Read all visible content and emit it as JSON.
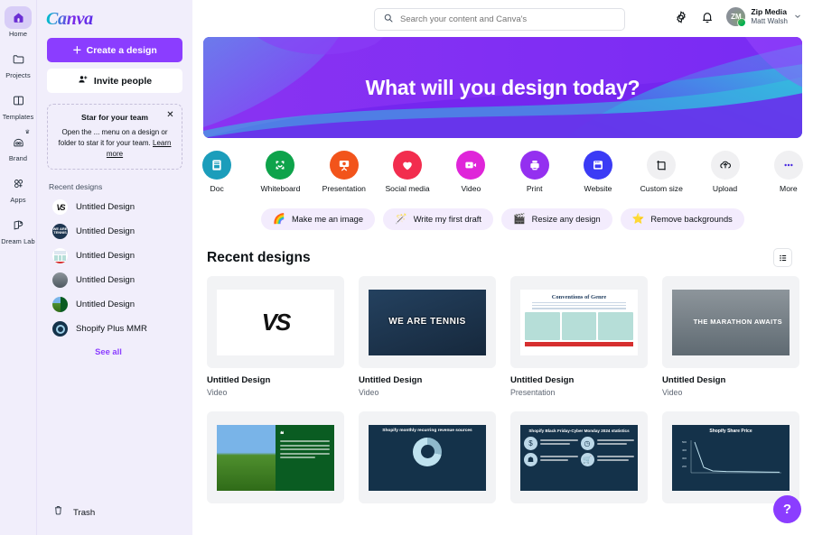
{
  "brand": {
    "logo_text": "Canva",
    "accent": "#8b3dff"
  },
  "rail": {
    "items": [
      {
        "label": "Home",
        "icon": "home-icon",
        "active": true
      },
      {
        "label": "Projects",
        "icon": "folder-icon",
        "active": false
      },
      {
        "label": "Templates",
        "icon": "templates-icon",
        "active": false
      },
      {
        "label": "Brand",
        "icon": "brand-icon",
        "active": false,
        "badge": "crown-icon"
      },
      {
        "label": "Apps",
        "icon": "apps-icon",
        "active": false
      },
      {
        "label": "Dream Lab",
        "icon": "dream-lab-icon",
        "active": false
      }
    ]
  },
  "sidebar": {
    "create_label": "Create a design",
    "invite_label": "Invite people",
    "tip": {
      "title": "Star for your team",
      "body": "Open the ... menu on a design or folder to star it for your team. ",
      "link": "Learn more",
      "close_icon": "close-icon"
    },
    "recent_heading": "Recent designs",
    "recent": [
      {
        "name": "Untitled Design",
        "thumb": "vs"
      },
      {
        "name": "Untitled Design",
        "thumb": "tennis"
      },
      {
        "name": "Untitled Design",
        "thumb": "genre"
      },
      {
        "name": "Untitled Design",
        "thumb": "marathon"
      },
      {
        "name": "Untitled Design",
        "thumb": "sunflower"
      },
      {
        "name": "Shopify Plus MMR",
        "thumb": "donut"
      }
    ],
    "see_all": "See all",
    "trash_label": "Trash"
  },
  "topbar": {
    "search_placeholder": "Search your content and Canva's",
    "search_value": "",
    "settings_icon": "gear-icon",
    "notifications_icon": "bell-icon",
    "account": {
      "initials": "ZM",
      "team": "Zip Media",
      "user": "Matt Walsh",
      "chevron": "chevron-down-icon"
    }
  },
  "hero": {
    "headline": "What will you design today?"
  },
  "categories": [
    {
      "label": "Doc",
      "color": "#1b9dbb",
      "icon": "doc-icon"
    },
    {
      "label": "Whiteboard",
      "color": "#0ea34b",
      "icon": "whiteboard-icon"
    },
    {
      "label": "Presentation",
      "color": "#f2541b",
      "icon": "presentation-icon"
    },
    {
      "label": "Social media",
      "color": "#f22d4e",
      "icon": "heart-icon"
    },
    {
      "label": "Video",
      "color": "#df25d9",
      "icon": "video-icon"
    },
    {
      "label": "Print",
      "color": "#9430f0",
      "icon": "printer-icon"
    },
    {
      "label": "Website",
      "color": "#3b3bf5",
      "icon": "browser-icon"
    },
    {
      "label": "Custom size",
      "color": "#f0f0f2",
      "icon": "custom-size-icon"
    },
    {
      "label": "Upload",
      "color": "#f0f0f2",
      "icon": "upload-cloud-icon"
    },
    {
      "label": "More",
      "color": "#f0f0f2",
      "icon": "more-dots-icon"
    }
  ],
  "pills": [
    {
      "label": "Make me an image",
      "icon": "rainbow-icon"
    },
    {
      "label": "Write my first draft",
      "icon": "magic-wand-icon"
    },
    {
      "label": "Resize any design",
      "icon": "resize-icon"
    },
    {
      "label": "Remove backgrounds",
      "icon": "star-icon"
    }
  ],
  "recent_section": {
    "title": "Recent designs",
    "view_toggle_icon": "list-view-icon",
    "cards": [
      {
        "name": "Untitled Design",
        "type": "Video",
        "art": "vs"
      },
      {
        "name": "Untitled Design",
        "type": "Video",
        "art": "tennis",
        "art_text": "WE ARE TENNIS"
      },
      {
        "name": "Untitled Design",
        "type": "Presentation",
        "art": "genre",
        "art_text": "Conventions of Genre"
      },
      {
        "name": "Untitled Design",
        "type": "Video",
        "art": "marathon",
        "art_text": "THE MARATHON AWAITS"
      },
      {
        "name": "",
        "type": "",
        "art": "sunflower"
      },
      {
        "name": "",
        "type": "",
        "art": "donut",
        "art_text": "Shopify monthly recurring revenue sources"
      },
      {
        "name": "",
        "type": "",
        "art": "stats",
        "art_text": "Shopify Black Friday-Cyber Monday 2024 statistics"
      },
      {
        "name": "",
        "type": "",
        "art": "share",
        "art_text": "Shopify Share Price"
      }
    ]
  },
  "help": {
    "label": "?",
    "icon": "help-icon"
  }
}
